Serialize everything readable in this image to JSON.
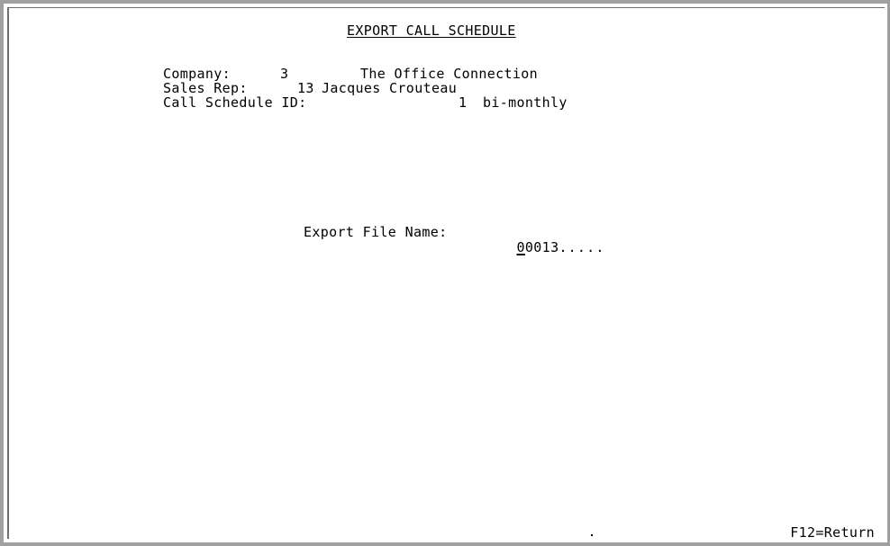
{
  "screen": {
    "title": "EXPORT CALL SCHEDULE"
  },
  "header": {
    "company_label": "Company:",
    "company_number": "3",
    "company_name": "The Office Connection",
    "sales_rep_label": "Sales Rep:",
    "sales_rep_number": "13",
    "sales_rep_name": "Jacques Crouteau",
    "call_schedule_label": "Call Schedule ID:",
    "call_schedule_number": "1",
    "call_schedule_description": "bi-monthly"
  },
  "form": {
    "export_file_label": "Export File Name:",
    "export_file_value_first": "0",
    "export_file_value_rest": "0013",
    "export_file_fill": "....."
  },
  "footer": {
    "f12": "F12=Return"
  }
}
